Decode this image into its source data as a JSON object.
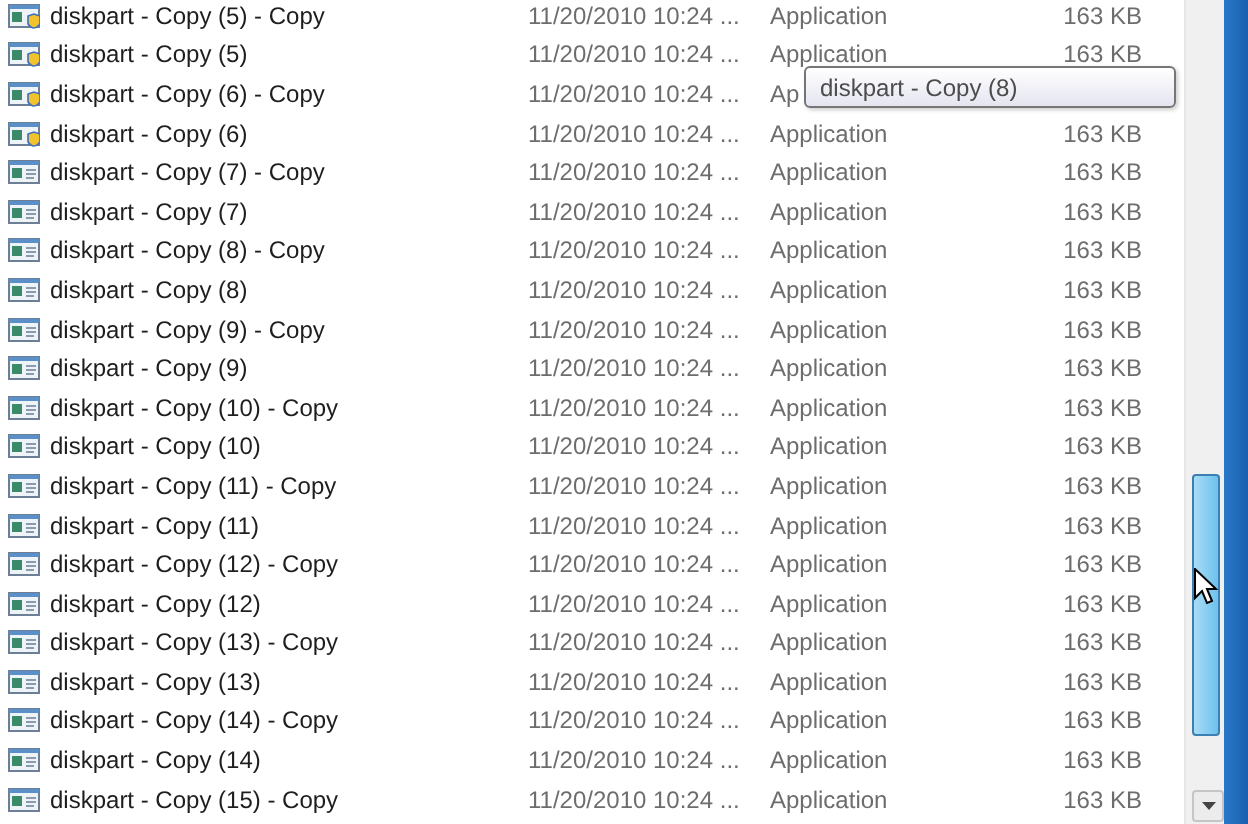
{
  "files": [
    {
      "name": "diskpart - Copy (5) - Copy",
      "date": "11/20/2010 10:24 ...",
      "type": "Application",
      "size": "163 KB",
      "kind": "shield"
    },
    {
      "name": "diskpart - Copy (5)",
      "date": "11/20/2010 10:24 ...",
      "type": "Application",
      "size": "163 KB",
      "kind": "shield"
    },
    {
      "name": "diskpart - Copy (6) - Copy",
      "date": "11/20/2010 10:24 ...",
      "type": "Ap",
      "kind": "shield"
    },
    {
      "name": "diskpart - Copy (6)",
      "date": "11/20/2010 10:24 ...",
      "type": "Application",
      "size": "163 KB",
      "kind": "shield"
    },
    {
      "name": "diskpart - Copy (7) - Copy",
      "date": "11/20/2010 10:24 ...",
      "type": "Application",
      "size": "163 KB",
      "kind": "plain"
    },
    {
      "name": "diskpart - Copy (7)",
      "date": "11/20/2010 10:24 ...",
      "type": "Application",
      "size": "163 KB",
      "kind": "plain"
    },
    {
      "name": "diskpart - Copy (8) - Copy",
      "date": "11/20/2010 10:24 ...",
      "type": "Application",
      "size": "163 KB",
      "kind": "plain"
    },
    {
      "name": "diskpart - Copy (8)",
      "date": "11/20/2010 10:24 ...",
      "type": "Application",
      "size": "163 KB",
      "kind": "plain"
    },
    {
      "name": "diskpart - Copy (9) - Copy",
      "date": "11/20/2010 10:24 ...",
      "type": "Application",
      "size": "163 KB",
      "kind": "plain"
    },
    {
      "name": "diskpart - Copy (9)",
      "date": "11/20/2010 10:24 ...",
      "type": "Application",
      "size": "163 KB",
      "kind": "plain"
    },
    {
      "name": "diskpart - Copy (10) - Copy",
      "date": "11/20/2010 10:24 ...",
      "type": "Application",
      "size": "163 KB",
      "kind": "plain"
    },
    {
      "name": "diskpart - Copy (10)",
      "date": "11/20/2010 10:24 ...",
      "type": "Application",
      "size": "163 KB",
      "kind": "plain"
    },
    {
      "name": "diskpart - Copy (11) - Copy",
      "date": "11/20/2010 10:24 ...",
      "type": "Application",
      "size": "163 KB",
      "kind": "plain"
    },
    {
      "name": "diskpart - Copy (11)",
      "date": "11/20/2010 10:24 ...",
      "type": "Application",
      "size": "163 KB",
      "kind": "plain"
    },
    {
      "name": "diskpart - Copy (12) - Copy",
      "date": "11/20/2010 10:24 ...",
      "type": "Application",
      "size": "163 KB",
      "kind": "plain"
    },
    {
      "name": "diskpart - Copy (12)",
      "date": "11/20/2010 10:24 ...",
      "type": "Application",
      "size": "163 KB",
      "kind": "plain"
    },
    {
      "name": "diskpart - Copy (13) - Copy",
      "date": "11/20/2010 10:24 ...",
      "type": "Application",
      "size": "163 KB",
      "kind": "plain"
    },
    {
      "name": "diskpart - Copy (13)",
      "date": "11/20/2010 10:24 ...",
      "type": "Application",
      "size": "163 KB",
      "kind": "plain"
    },
    {
      "name": "diskpart - Copy (14) - Copy",
      "date": "11/20/2010 10:24 ...",
      "type": "Application",
      "size": "163 KB",
      "kind": "plain"
    },
    {
      "name": "diskpart - Copy (14)",
      "date": "11/20/2010 10:24 ...",
      "type": "Application",
      "size": "163 KB",
      "kind": "plain"
    },
    {
      "name": "diskpart - Copy (15) - Copy",
      "date": "11/20/2010 10:24 ...",
      "type": "Application",
      "size": "163 KB",
      "kind": "plain"
    }
  ],
  "tooltip": {
    "text": "diskpart - Copy (8)"
  }
}
